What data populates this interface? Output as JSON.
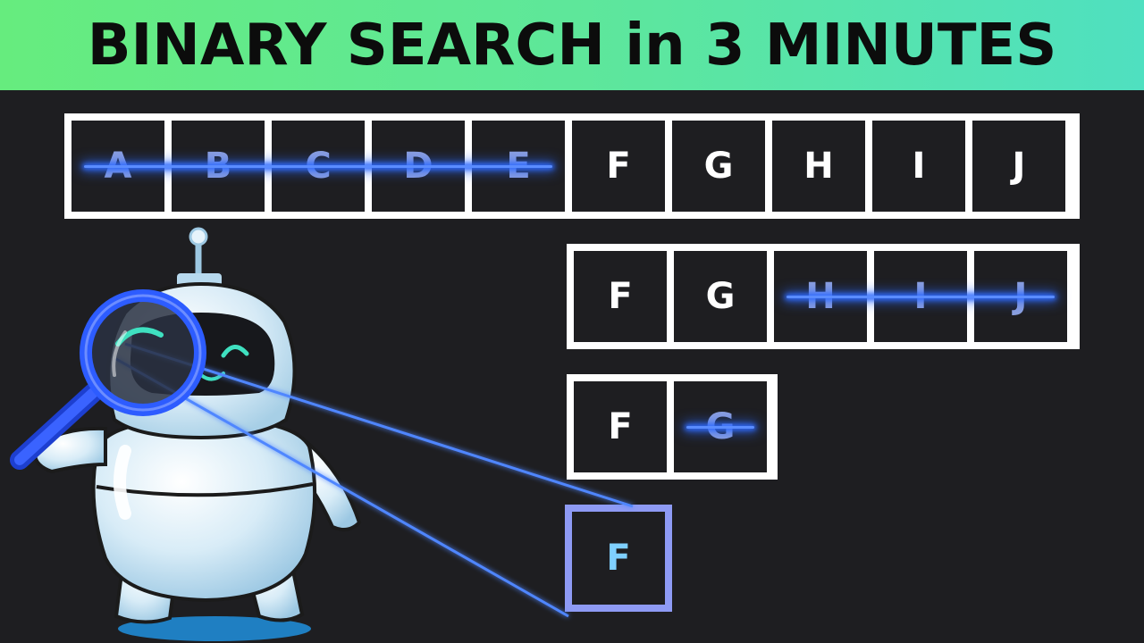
{
  "title": "BINARY SEARCH in 3 MINUTES",
  "rows": [
    {
      "cells": [
        {
          "letter": "A",
          "crossed": true
        },
        {
          "letter": "B",
          "crossed": true
        },
        {
          "letter": "C",
          "crossed": true
        },
        {
          "letter": "D",
          "crossed": true
        },
        {
          "letter": "E",
          "crossed": true
        },
        {
          "letter": "F",
          "crossed": false
        },
        {
          "letter": "G",
          "crossed": false
        },
        {
          "letter": "H",
          "crossed": false
        },
        {
          "letter": "I",
          "crossed": false
        },
        {
          "letter": "J",
          "crossed": false
        }
      ]
    },
    {
      "cells": [
        {
          "letter": "F",
          "crossed": false
        },
        {
          "letter": "G",
          "crossed": false
        },
        {
          "letter": "H",
          "crossed": true
        },
        {
          "letter": "I",
          "crossed": true
        },
        {
          "letter": "J",
          "crossed": true
        }
      ]
    },
    {
      "cells": [
        {
          "letter": "F",
          "crossed": false
        },
        {
          "letter": "G",
          "crossed": true
        }
      ]
    }
  ],
  "result": "F",
  "colors": {
    "banner_start": "#66ec7e",
    "banner_end": "#4fe0c0",
    "background": "#1e1e21",
    "strike_glow": "#2f6bff",
    "result_border": "#8e9af4"
  },
  "icons": [
    "robot-mascot",
    "magnifying-glass-icon"
  ]
}
